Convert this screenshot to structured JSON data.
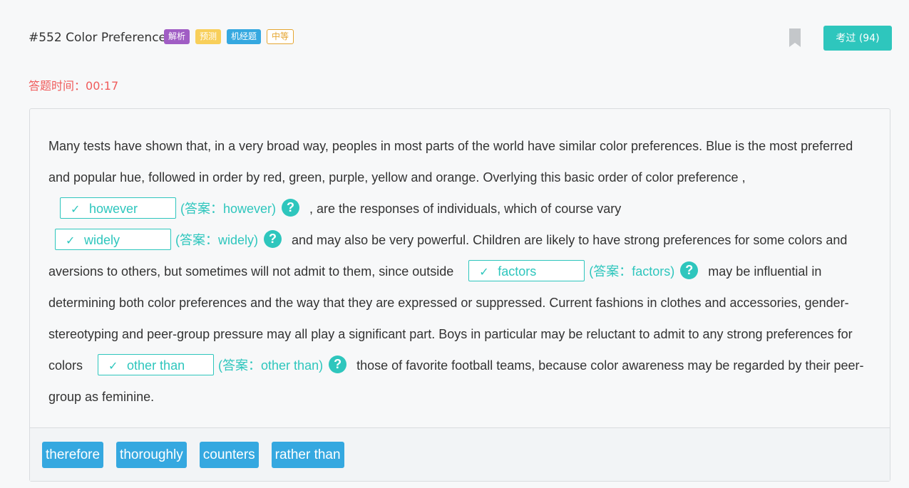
{
  "header": {
    "title": "#552 Color Preference",
    "tags": [
      "解析",
      "预测",
      "机经题",
      "中等"
    ],
    "taken_button": "考过 (94)"
  },
  "timer": {
    "label": "答题时间：",
    "value": "00:17"
  },
  "passage": {
    "p1": "Many tests have shown that, in a very broad way, peoples in most parts of the world have similar color preferences. Blue is the most preferred and popular hue, followed in order by red, green, purple, yellow and orange. Overlying this basic order of color preference ,",
    "blank1": "however",
    "ans1": "(答案：however)",
    "p2": ", are the responses of individuals, which of course vary",
    "blank2": "widely",
    "ans2": "(答案：widely)",
    "p3": "and may also be very powerful. Children are likely to have strong preferences for some colors and aversions to others, but sometimes will not admit to them, since outside",
    "blank3": "factors",
    "ans3": "(答案：factors)",
    "p4": "may be influential in determining both color preferences and the way that they are expressed or suppressed. Current fashions in clothes and accessories, gender-stereotyping and peer-group pressure may all play a significant part. Boys in particular may be reluctant to admit to any strong preferences for colors",
    "blank4": "other than",
    "ans4": "(答案：other than)",
    "p5": "those of favorite football teams, because color awareness may be regarded by their peer-group as feminine.",
    "check": "✓",
    "help": "?"
  },
  "options": [
    "therefore",
    "thoroughly",
    "counters",
    "rather than"
  ]
}
